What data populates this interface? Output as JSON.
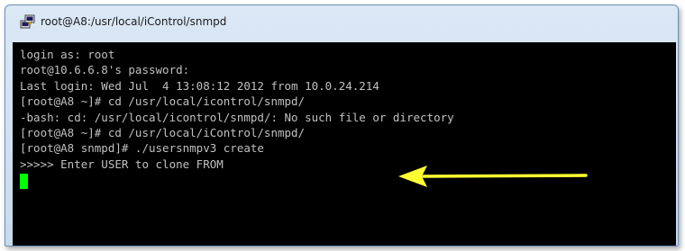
{
  "window": {
    "title": "root@A8:/usr/local/iControl/snmpd"
  },
  "terminal": {
    "lines": [
      "login as: root",
      "root@10.6.6.8's password:",
      "Last login: Wed Jul  4 13:08:12 2012 from 10.0.24.214",
      "[root@A8 ~]# cd /usr/local/icontrol/snmpd/",
      "-bash: cd: /usr/local/icontrol/snmpd/: No such file or directory",
      "[root@A8 ~]# cd /usr/local/iControl/snmpd/",
      "[root@A8 snmpd]# ./usersnmpv3 create",
      ">>>>> Enter USER to clone FROM"
    ],
    "cursor_color": "#00ff00",
    "background_color": "#000000",
    "text_color": "#c0c0c0"
  },
  "annotation": {
    "arrow_color": "#ffff33",
    "icon": "left-arrow-icon"
  }
}
